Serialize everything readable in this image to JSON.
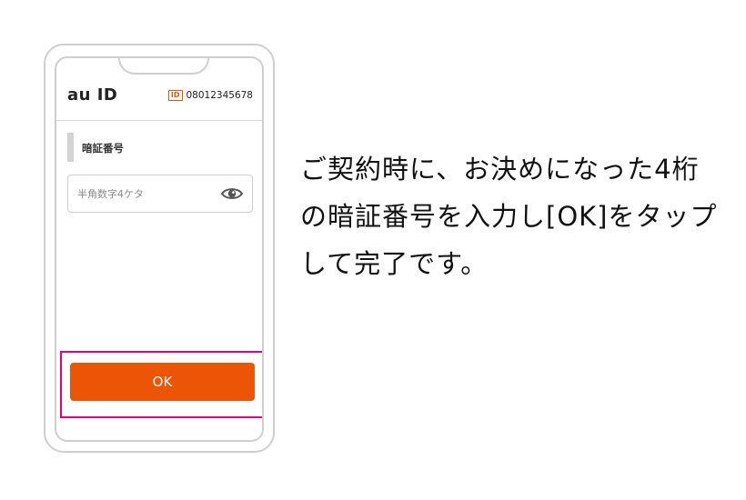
{
  "app": {
    "logo": "au ID",
    "id_badge": "ID",
    "id_number": "08012345678"
  },
  "form": {
    "section_label": "暗証番号",
    "pin_placeholder": "半角数字4ケタ",
    "pin_value": "",
    "toggle_icon": "eye-icon",
    "ok_label": "OK"
  },
  "colors": {
    "accent": "#eb5505",
    "highlight": "#e4007f",
    "frame": "#cfcfcf"
  },
  "instruction": {
    "text": "ご契約時に、お決めになった4桁の暗証番号を入力し[OK]をタップして完了です。"
  }
}
